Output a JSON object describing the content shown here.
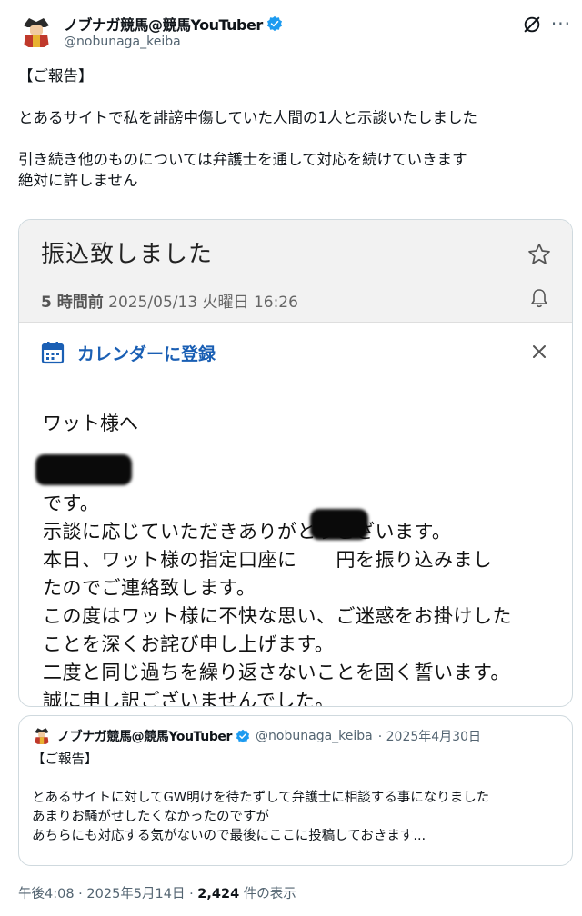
{
  "author": {
    "display_name": "ノブナガ競馬@競馬YouTuber",
    "handle": "@nobunaga_keiba"
  },
  "tweet": {
    "text": "【ご報告】\n\nとあるサイトで私を誹謗中傷していた人間の1人と示談いたしました\n\n引き続き他のものについては弁護士を通して対応を続けていきます\n絶対に許しません"
  },
  "email_screenshot": {
    "subject": "振込致しました",
    "time_relative": "5 時間前",
    "time_absolute": "2025/05/13 火曜日 16:26",
    "calendar_label": "カレンダーに登録",
    "greeting": "ワット様へ",
    "body": "です。\n示談に応じていただきありがとうございます。\n本日、ワット様の指定口座に　　円を振り込みまし\nたのでご連絡致します。\nこの度はワット様に不快な思い、ご迷惑をお掛けした\nことを深くお詫び申し上げます。\n二度と同じ過ちを繰り返さないことを固く誓います。\n誠に申し訳ございませんでした。"
  },
  "quoted_tweet": {
    "display_name": "ノブナガ競馬@競馬YouTuber",
    "handle": "@nobunaga_keiba",
    "date": "· 2025年4月30日",
    "text": "【ご報告】\n\nとあるサイトに対してGW明けを待たずして弁護士に相談する事になりました\nあまりお騒がせしたくなかったのですが\nあちらにも対応する気がないので最後にここに投稿しておきます..."
  },
  "footer": {
    "time": "午後4:08 · 2025年5月14日 · ",
    "views": "2,424",
    "views_suffix": " 件の表示"
  },
  "colors": {
    "verified": "#1d9bf0",
    "link_blue": "#1a5fb4"
  }
}
